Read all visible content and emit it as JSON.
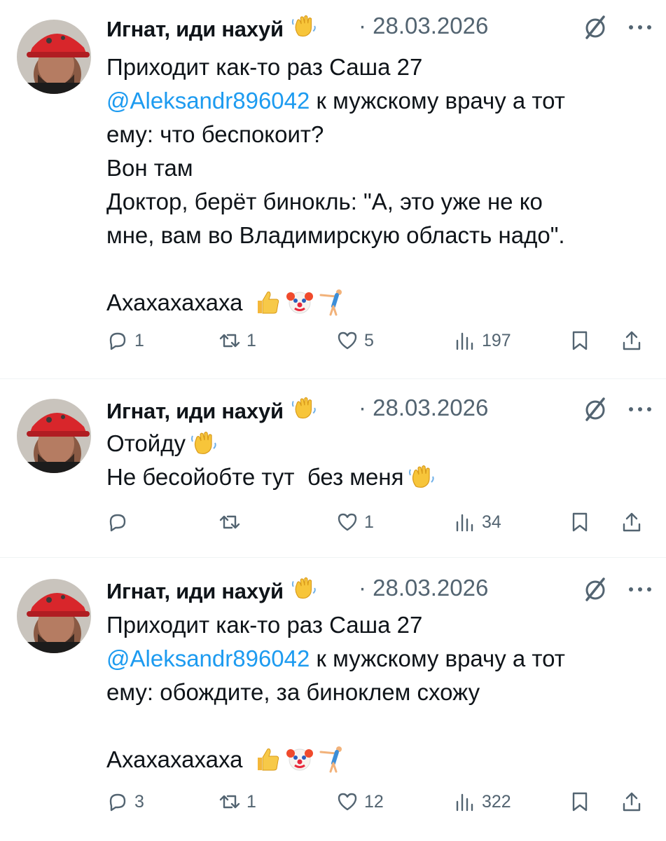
{
  "tweets": [
    {
      "author": "Игнат, иди нахуй",
      "date": "· 28.03.2026",
      "lines": [
        {
          "text": "Приходит как-то раз Саша 27"
        },
        {
          "mention": "@Aleksandr896042",
          "text": " к мужскому врачу а тот"
        },
        {
          "text": "ему: что беспокоит?"
        },
        {
          "text": "Вон там"
        },
        {
          "text": "Доктор, берёт бинокль: \"А, это уже не ко"
        },
        {
          "text": "мне, вам во Владимирскую область надо\"."
        },
        {
          "text": ""
        },
        {
          "text": "Ахахахахаха",
          "emoji": [
            "thumbs-up",
            "clown",
            "person-cartwheel"
          ]
        }
      ],
      "actions": {
        "replies": "1",
        "reposts": "1",
        "likes": "5",
        "views": "197"
      }
    },
    {
      "author": "Игнат, иди нахуй",
      "date": "· 28.03.2026",
      "lines": [
        {
          "text": "Отойду",
          "emoji": [
            "waving-hand"
          ]
        },
        {
          "text": "Не бесойобте тут  без меня",
          "emoji": [
            "waving-hand"
          ]
        }
      ],
      "actions": {
        "replies": "",
        "reposts": "",
        "likes": "1",
        "views": "34"
      }
    },
    {
      "author": "Игнат, иди нахуй",
      "date": "· 28.03.2026",
      "lines": [
        {
          "text": "Приходит как-то раз Саша 27"
        },
        {
          "mention": "@Aleksandr896042",
          "text": " к мужскому врачу а тот"
        },
        {
          "text": "ему: обождите, за биноклем схожу"
        },
        {
          "text": ""
        },
        {
          "text": "Ахахахахаха",
          "emoji": [
            "thumbs-up",
            "clown",
            "person-cartwheel"
          ]
        }
      ],
      "actions": {
        "replies": "3",
        "reposts": "1",
        "likes": "12",
        "views": "322"
      }
    }
  ],
  "colors": {
    "text": "#0f1419",
    "secondary": "#536471",
    "mention": "#1d9bf0",
    "divider": "#eff3f4"
  }
}
